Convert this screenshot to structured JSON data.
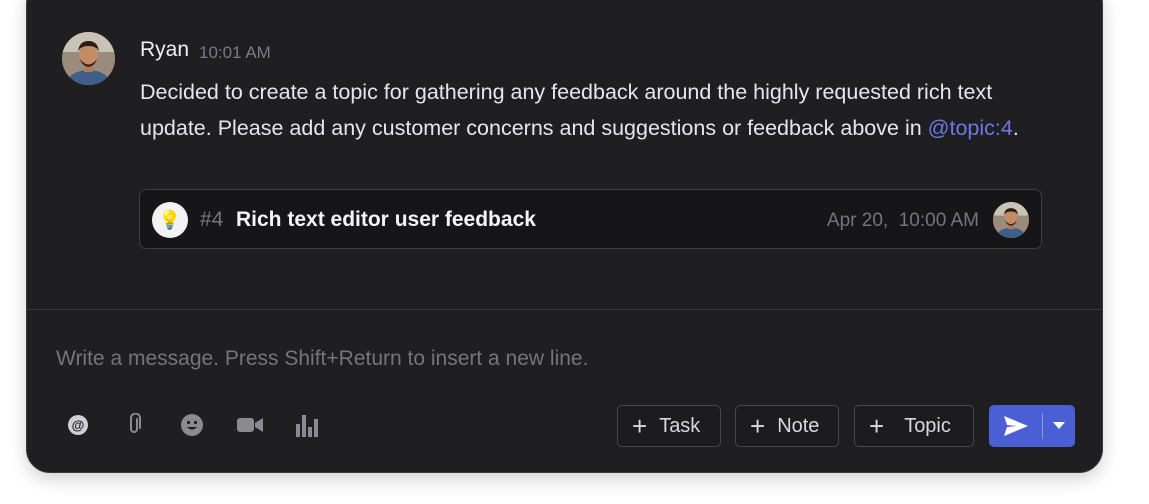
{
  "message": {
    "author": "Ryan",
    "time": "10:01 AM",
    "body_pre": "Decided to create a topic for gathering any feedback around the highly requested rich text update. Please add any customer concerns and suggestions or feedback above in ",
    "mention": "@topic:4",
    "body_post": "."
  },
  "topic_card": {
    "icon": "lightbulb-icon",
    "number": "#4",
    "title": "Rich text editor user feedback",
    "date": "Apr 20,  10:00 AM"
  },
  "composer": {
    "placeholder": "Write a message. Press Shift+Return to insert a new line."
  },
  "toolbar": {
    "icons": [
      "at-sign-icon",
      "paperclip-icon",
      "emoji-icon",
      "video-icon",
      "poll-icon"
    ],
    "task_label": "Task",
    "note_label": "Note",
    "topic_label": "Topic",
    "send_icon": "send-icon",
    "send_menu_icon": "caret-down-icon"
  },
  "colors": {
    "background": "#1f1f22",
    "accent": "#4a5fd4",
    "mention": "#6b78e5"
  }
}
